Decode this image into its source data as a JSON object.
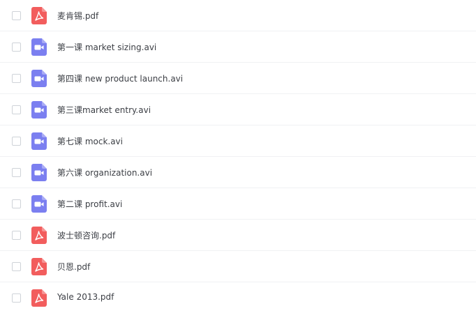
{
  "files": [
    {
      "name": "麦肯锡.pdf",
      "type": "pdf"
    },
    {
      "name": "第一课 market sizing.avi",
      "type": "video"
    },
    {
      "name": "第四课 new product launch.avi",
      "type": "video"
    },
    {
      "name": "第三课market entry.avi",
      "type": "video"
    },
    {
      "name": "第七课 mock.avi",
      "type": "video"
    },
    {
      "name": "第六课 organization.avi",
      "type": "video"
    },
    {
      "name": "第二课 profit.avi",
      "type": "video"
    },
    {
      "name": "波士顿咨询.pdf",
      "type": "pdf"
    },
    {
      "name": "贝恩.pdf",
      "type": "pdf"
    },
    {
      "name": "Yale 2013.pdf",
      "type": "pdf"
    }
  ],
  "colors": {
    "pdf_icon": "#f25d5d",
    "video_icon": "#7b7ff0",
    "text": "#3b3e44",
    "divider": "#f0f1f3"
  },
  "icons": {
    "pdf": "pdf-file-icon",
    "video": "video-file-icon"
  }
}
